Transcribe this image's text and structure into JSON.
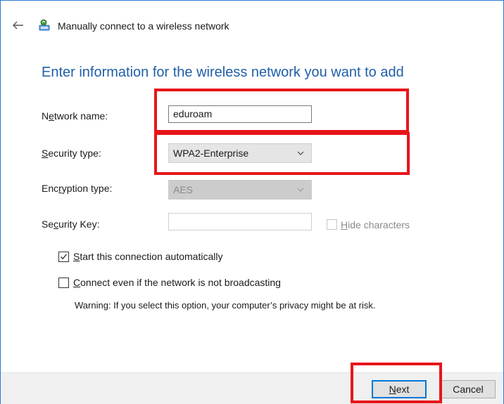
{
  "window": {
    "title": "Manually connect to a wireless network",
    "back_icon": "back-arrow-icon",
    "app_icon": "wireless-network-icon"
  },
  "heading": "Enter information for the wireless network you want to add",
  "fields": {
    "network_name": {
      "label_pre": "N",
      "label_mn": "e",
      "label_post": "twork name:",
      "value": "eduroam"
    },
    "security_type": {
      "label_mn": "S",
      "label_post": "ecurity type:",
      "value": "WPA2-Enterprise"
    },
    "encryption_type": {
      "label_pre": "Enc",
      "label_mn": "r",
      "label_post": "yption type:",
      "value": "AES"
    },
    "security_key": {
      "label_pre": "Se",
      "label_mn": "c",
      "label_post": "urity Key:",
      "value": ""
    },
    "hide_characters": {
      "label_mn": "H",
      "label_post": "ide characters",
      "checked": false
    }
  },
  "options": {
    "start_automatically": {
      "label_mn": "S",
      "label_post": "tart this connection automatically",
      "checked": true
    },
    "connect_hidden": {
      "label_mn": "C",
      "label_post": "onnect even if the network is not broadcasting",
      "checked": false
    },
    "warning": "Warning: If you select this option, your computer’s privacy might be at risk."
  },
  "buttons": {
    "next": {
      "label_mn": "N",
      "label_post": "ext"
    },
    "cancel": "Cancel"
  },
  "colors": {
    "heading": "#1f5fa8",
    "frame_border": "#2b7bd3",
    "annotation": "#e8141b",
    "default_button_border": "#0078d7"
  }
}
